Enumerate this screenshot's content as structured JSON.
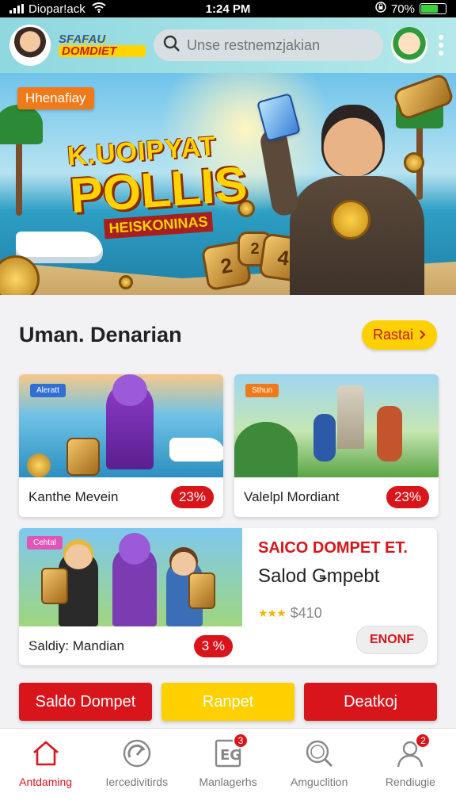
{
  "status_bar": {
    "carrier": "Diopar!ack",
    "time": "1:24 PM",
    "battery": "70%",
    "battery_level": 0.7
  },
  "header": {
    "logo_line1": "SFAFAU",
    "logo_line2": "DOMDIET",
    "search_placeholder": "Unse restnemzjakian"
  },
  "banner": {
    "tag": "Hhenafiay",
    "title_line1": "K.UOIPYAT",
    "title_line2": "POLLIS",
    "title_line3": "HEISKONINAS",
    "coins": [
      "2",
      "2",
      "4"
    ]
  },
  "section": {
    "title": "Uman. Denarian",
    "more_label": "Rastai"
  },
  "cards": [
    {
      "chip": "Aleratt",
      "name": "Kanthe Mevein",
      "percent": "23%"
    },
    {
      "chip": "Sthun",
      "name": "Valelpl Mordiant",
      "percent": "23%"
    }
  ],
  "wide_card": {
    "chip": "Cehtal",
    "name": "Saldiy: Mandian",
    "percent": "3 %",
    "promo_title": "SAICO DOMPET ET.",
    "promo_sub": "Salod Ǥmpebt",
    "price": "$410",
    "stars": "★★★",
    "cta": "ENONF"
  },
  "actions": {
    "primary": "Saldo Dompet",
    "secondary": "Ranpet",
    "tertiary": "Deatkoj"
  },
  "nav": [
    {
      "label": "Antdaming",
      "icon": "home-icon",
      "badge": ""
    },
    {
      "label": "Iercedivitirds",
      "icon": "speed-icon",
      "badge": ""
    },
    {
      "label": "Manlagerhs",
      "icon": "ticket-icon",
      "badge": "3"
    },
    {
      "label": "Amguclition",
      "icon": "search-icon",
      "badge": ""
    },
    {
      "label": "Rendiugie",
      "icon": "profile-icon",
      "badge": "2"
    }
  ],
  "colors": {
    "accent_red": "#d8151b",
    "accent_yellow": "#ffd000",
    "header_teal": "#8fd8df"
  }
}
